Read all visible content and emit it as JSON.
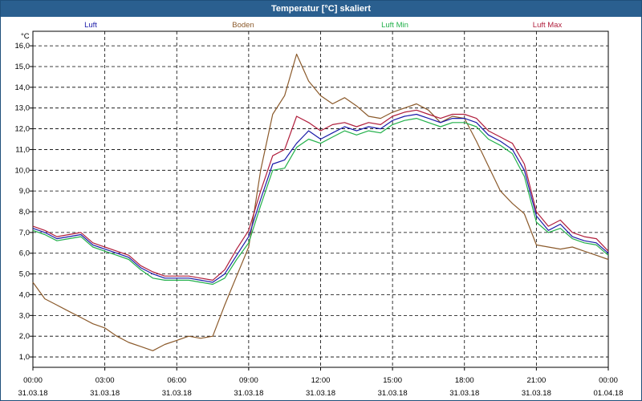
{
  "window": {
    "title": "Temperatur [°C] skaliert"
  },
  "chart_data": {
    "type": "line",
    "title": "Temperatur [°C] skaliert",
    "y_unit": "°C",
    "ylim": [
      0.5,
      16.7
    ],
    "y_ticks": [
      "1,0",
      "2,0",
      "3,0",
      "4,0",
      "5,0",
      "6,0",
      "7,0",
      "8,0",
      "9,0",
      "10,0",
      "11,0",
      "12,0",
      "13,0",
      "14,0",
      "15,0",
      "16,0"
    ],
    "x_range_hours": [
      0,
      24
    ],
    "x_ticks": [
      {
        "time": "00:00",
        "date": "31.03.18"
      },
      {
        "time": "03:00",
        "date": "31.03.18"
      },
      {
        "time": "06:00",
        "date": "31.03.18"
      },
      {
        "time": "09:00",
        "date": "31.03.18"
      },
      {
        "time": "12:00",
        "date": "31.03.18"
      },
      {
        "time": "15:00",
        "date": "31.03.18"
      },
      {
        "time": "18:00",
        "date": "31.03.18"
      },
      {
        "time": "21:00",
        "date": "31.03.18"
      },
      {
        "time": "00:00",
        "date": "01.04.18"
      }
    ],
    "grid": true,
    "legend_position": "top",
    "series": [
      {
        "name": "Luft",
        "color": "#1a1aa8",
        "x": [
          0,
          0.5,
          1,
          1.5,
          2,
          2.5,
          3,
          3.5,
          4,
          4.5,
          5,
          5.5,
          6,
          6.5,
          7,
          7.5,
          8,
          8.5,
          9,
          9.5,
          10,
          10.5,
          11,
          11.5,
          12,
          12.5,
          13,
          13.5,
          14,
          14.5,
          15,
          15.5,
          16,
          16.5,
          17,
          17.5,
          18,
          18.5,
          19,
          19.5,
          20,
          20.5,
          21,
          21.5,
          22,
          22.5,
          23,
          23.5,
          24
        ],
        "values": [
          7.2,
          7.0,
          6.7,
          6.8,
          6.9,
          6.4,
          6.2,
          6.0,
          5.8,
          5.3,
          5.0,
          4.8,
          4.8,
          4.8,
          4.7,
          4.6,
          5.0,
          5.9,
          6.8,
          8.6,
          10.3,
          10.5,
          11.3,
          11.9,
          11.5,
          11.8,
          12.1,
          11.9,
          12.1,
          12.0,
          12.4,
          12.6,
          12.7,
          12.5,
          12.3,
          12.5,
          12.5,
          12.3,
          11.7,
          11.4,
          11.0,
          10.0,
          7.8,
          7.1,
          7.4,
          6.8,
          6.6,
          6.5,
          6.0
        ]
      },
      {
        "name": "Boden",
        "color": "#8b5a2b",
        "x": [
          0,
          0.5,
          1,
          1.5,
          2,
          2.5,
          3,
          3.5,
          4,
          4.5,
          5,
          5.5,
          6,
          6.5,
          7,
          7.5,
          8,
          8.5,
          9,
          9.5,
          10,
          10.5,
          11,
          11.5,
          12,
          12.5,
          13,
          13.5,
          14,
          14.5,
          15,
          15.5,
          16,
          16.5,
          17,
          17.5,
          18,
          18.5,
          19,
          19.5,
          20,
          20.5,
          21,
          21.5,
          22,
          22.5,
          23,
          23.5,
          24
        ],
        "values": [
          4.6,
          3.8,
          3.5,
          3.2,
          2.9,
          2.6,
          2.4,
          2.0,
          1.7,
          1.5,
          1.3,
          1.6,
          1.8,
          2.0,
          1.9,
          2.0,
          3.5,
          4.9,
          6.3,
          10.0,
          12.7,
          13.6,
          15.6,
          14.3,
          13.6,
          13.2,
          13.5,
          13.1,
          12.6,
          12.5,
          12.8,
          13.0,
          13.2,
          12.9,
          12.3,
          12.6,
          12.5,
          11.4,
          10.2,
          9.0,
          8.4,
          7.9,
          6.4,
          6.3,
          6.2,
          6.3,
          6.1,
          5.9,
          5.7
        ]
      },
      {
        "name": "Luft Min",
        "color": "#22b04a",
        "x": [
          0,
          0.5,
          1,
          1.5,
          2,
          2.5,
          3,
          3.5,
          4,
          4.5,
          5,
          5.5,
          6,
          6.5,
          7,
          7.5,
          8,
          8.5,
          9,
          9.5,
          10,
          10.5,
          11,
          11.5,
          12,
          12.5,
          13,
          13.5,
          14,
          14.5,
          15,
          15.5,
          16,
          16.5,
          17,
          17.5,
          18,
          18.5,
          19,
          19.5,
          20,
          20.5,
          21,
          21.5,
          22,
          22.5,
          23,
          23.5,
          24
        ],
        "values": [
          7.1,
          6.9,
          6.6,
          6.7,
          6.8,
          6.3,
          6.1,
          5.9,
          5.7,
          5.2,
          4.8,
          4.7,
          4.7,
          4.7,
          4.6,
          4.5,
          4.8,
          5.7,
          6.5,
          8.3,
          10.0,
          10.1,
          11.1,
          11.5,
          11.3,
          11.6,
          11.9,
          11.7,
          11.9,
          11.8,
          12.2,
          12.4,
          12.5,
          12.3,
          12.1,
          12.3,
          12.3,
          12.1,
          11.5,
          11.2,
          10.8,
          9.7,
          7.5,
          7.0,
          7.2,
          6.7,
          6.5,
          6.4,
          5.9
        ]
      },
      {
        "name": "Luft Max",
        "color": "#b01e3c",
        "x": [
          0,
          0.5,
          1,
          1.5,
          2,
          2.5,
          3,
          3.5,
          4,
          4.5,
          5,
          5.5,
          6,
          6.5,
          7,
          7.5,
          8,
          8.5,
          9,
          9.5,
          10,
          10.5,
          11,
          11.5,
          12,
          12.5,
          13,
          13.5,
          14,
          14.5,
          15,
          15.5,
          16,
          16.5,
          17,
          17.5,
          18,
          18.5,
          19,
          19.5,
          20,
          20.5,
          21,
          21.5,
          22,
          22.5,
          23,
          23.5,
          24
        ],
        "values": [
          7.3,
          7.1,
          6.8,
          6.9,
          7.0,
          6.5,
          6.3,
          6.1,
          5.9,
          5.4,
          5.1,
          4.9,
          4.9,
          4.9,
          4.8,
          4.7,
          5.2,
          6.2,
          7.1,
          9.0,
          10.7,
          11.0,
          12.6,
          12.3,
          11.9,
          12.2,
          12.3,
          12.1,
          12.3,
          12.2,
          12.6,
          12.8,
          12.9,
          12.7,
          12.5,
          12.7,
          12.7,
          12.5,
          11.9,
          11.6,
          11.3,
          10.3,
          8.0,
          7.3,
          7.6,
          7.0,
          6.8,
          6.7,
          6.1
        ]
      }
    ]
  }
}
